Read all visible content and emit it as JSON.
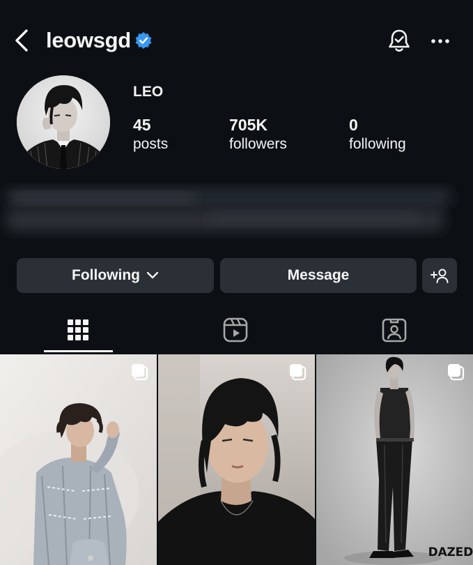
{
  "header": {
    "back_icon": "chevron-left-icon",
    "username": "leowsgd",
    "verified_icon": "verified-badge-icon",
    "notifications_icon": "bell-check-icon",
    "more_icon": "ellipsis-icon"
  },
  "profile": {
    "display_name": "LEO",
    "stats": [
      {
        "value": "45",
        "label": "posts"
      },
      {
        "value": "705K",
        "label": "followers"
      },
      {
        "value": "0",
        "label": "following"
      }
    ]
  },
  "actions": {
    "following_label": "Following",
    "message_label": "Message",
    "add_person_icon": "add-person-icon",
    "chevron_icon": "chevron-down-icon"
  },
  "tabs": [
    {
      "icon": "grid-icon",
      "active": true
    },
    {
      "icon": "reels-icon",
      "active": false
    },
    {
      "icon": "tagged-icon",
      "active": false
    }
  ],
  "posts": [
    {
      "type": "carousel"
    },
    {
      "type": "carousel"
    },
    {
      "type": "carousel",
      "watermark": "DAZED"
    }
  ],
  "colors": {
    "background": "#0c1014",
    "button": "#2b3036",
    "verified": "#3897f0",
    "text": "#f5f5f5"
  }
}
